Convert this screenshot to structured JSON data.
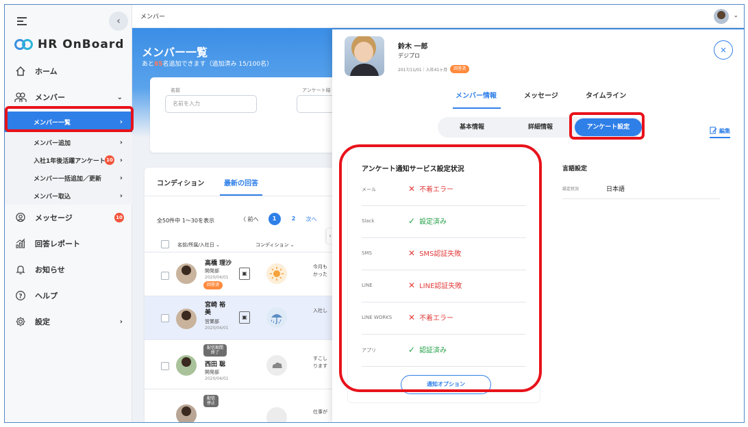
{
  "sidebar": {
    "logo": "HR OnBoard",
    "collapse": "‹",
    "nav": [
      {
        "label": "ホーム",
        "icon": "home-icon"
      },
      {
        "label": "メンバー",
        "icon": "members-icon",
        "arrow": "⌄"
      }
    ],
    "sub_items": [
      {
        "label": "メンバー一覧",
        "arrow": "›"
      },
      {
        "label": "メンバー追加",
        "arrow": "›"
      },
      {
        "label": "入社1年後活躍アンケート",
        "badge": "10",
        "arrow": "›"
      },
      {
        "label": "メンバー一括追加／更新",
        "arrow": "›"
      },
      {
        "label": "メンバー取込",
        "arrow": "›"
      }
    ],
    "nav_bottom": [
      {
        "label": "メッセージ",
        "icon": "message-icon",
        "badge": "10"
      },
      {
        "label": "回答レポート",
        "icon": "report-icon"
      },
      {
        "label": "お知らせ",
        "icon": "bell-icon"
      },
      {
        "label": "ヘルプ",
        "icon": "help-icon"
      },
      {
        "label": "設定",
        "icon": "gear-icon",
        "arrow": "›"
      }
    ]
  },
  "topbar": {
    "title": "メンバー",
    "caret": "⌄"
  },
  "main": {
    "title": "メンバー一覧",
    "subtitle_pre": "あと",
    "subtitle_hl": "85",
    "subtitle_post": "名追加できます（追加済み 15/100名）",
    "filter": {
      "name_label": "名前",
      "name_placeholder": "名前を入力",
      "survey_label": "アンケート結"
    },
    "tabs": [
      "コンディション",
      "最新の回答"
    ],
    "count": "全50件中 1〜30を表示",
    "pager": {
      "prev": "〈 前へ",
      "pages": [
        "1",
        "2"
      ],
      "next": "次へ"
    },
    "col_name": "名前/所属/入社日 ⌄",
    "col_condition": "コンディション ⌄",
    "rows": [
      {
        "name": "高橋 理沙",
        "dept": "開発部",
        "date": "2020/04/01",
        "pill": "回答済",
        "msg": "今月も\nかった"
      },
      {
        "name": "宮崎 裕\n美",
        "dept": "営業部",
        "date": "2020/04/01",
        "msg": "入社し"
      },
      {
        "name": "西田 聡",
        "dept": "開発部",
        "date": "2020/04/01",
        "status": "配信期間\n終了",
        "msg": "すこし\nります"
      },
      {
        "name": "",
        "status": "配信\n停止",
        "msg": "仕事が"
      }
    ]
  },
  "panel": {
    "name": "鈴木 一郎",
    "company": "デジプロ",
    "meta": "2017/11/01｜入社41ヶ月",
    "pill": "回答済",
    "close": "×",
    "tabs": [
      "メンバー情報",
      "メッセージ",
      "タイムライン"
    ],
    "segments": [
      "基本情報",
      "詳細情報",
      "アンケート設定"
    ],
    "edit": "編集",
    "notify": {
      "title": "アンケート通知サービス設定状況",
      "rows": [
        {
          "label": "メール",
          "value": "不着エラー",
          "ok": false
        },
        {
          "label": "Slack",
          "value": "設定済み",
          "ok": true
        },
        {
          "label": "SMS",
          "value": "SMS認証失敗",
          "ok": false
        },
        {
          "label": "LINE",
          "value": "LINE認証失敗",
          "ok": false
        },
        {
          "label": "LINE WORKS",
          "value": "不着エラー",
          "ok": false
        },
        {
          "label": "アプリ",
          "value": "認証済み",
          "ok": true
        }
      ],
      "button": "通知オプション"
    },
    "lang": {
      "title": "言語設定",
      "label": "設定状況",
      "value": "日本語"
    }
  },
  "colors": {
    "accent": "#2f7fe8",
    "error": "#e23b3b",
    "ok": "#22a045",
    "annotation": "#e8121b"
  }
}
